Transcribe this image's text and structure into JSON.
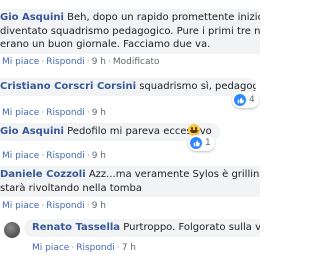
{
  "comments": [
    {
      "author": "Gio Asquini",
      "lines": [
        "Beh, dopo un rapido promettente inizio è orma",
        "diventato squadrismo pedagogico. Pure i primi tre numeri c",
        "erano un buon giornale. Facciamo due va."
      ],
      "like": "Mi piace",
      "reply": "Rispondi",
      "time": "9 h",
      "edited": "Modificato"
    },
    {
      "author": "Cristiano Corscri Corsini",
      "text": "squadrismo sì, pedagogico no",
      "like": "Mi piace",
      "reply": "Rispondi",
      "time": "9 h",
      "reactions": "4"
    },
    {
      "author": "Gio Asquini",
      "text": "Pedofilo mi pareva eccessivo",
      "like": "Mi piace",
      "reply": "Rispondi",
      "time": "9 h",
      "reactions": "1"
    },
    {
      "author": "Daniele Cozzoli",
      "lines": [
        "Azz...ma veramente Sylos è grillino? Il pad",
        "starà rivoltando nella tomba"
      ],
      "like": "Mi piace",
      "reply": "Rispondi",
      "time": "9 h"
    },
    {
      "author": "Renato Tassella",
      "text": "Purtroppo. Folgorato sulla via di Ge",
      "like": "Mi piace",
      "reply": "Rispondi",
      "time": "7 h"
    }
  ],
  "icons": {
    "like": "like-icon",
    "smile": "grinning-emoji-icon",
    "avatar": "user-avatar"
  },
  "colors": {
    "author": "#385898",
    "bubble": "#f2f3f5",
    "link": "#4267b2",
    "like_badge": "#2d88ff"
  }
}
